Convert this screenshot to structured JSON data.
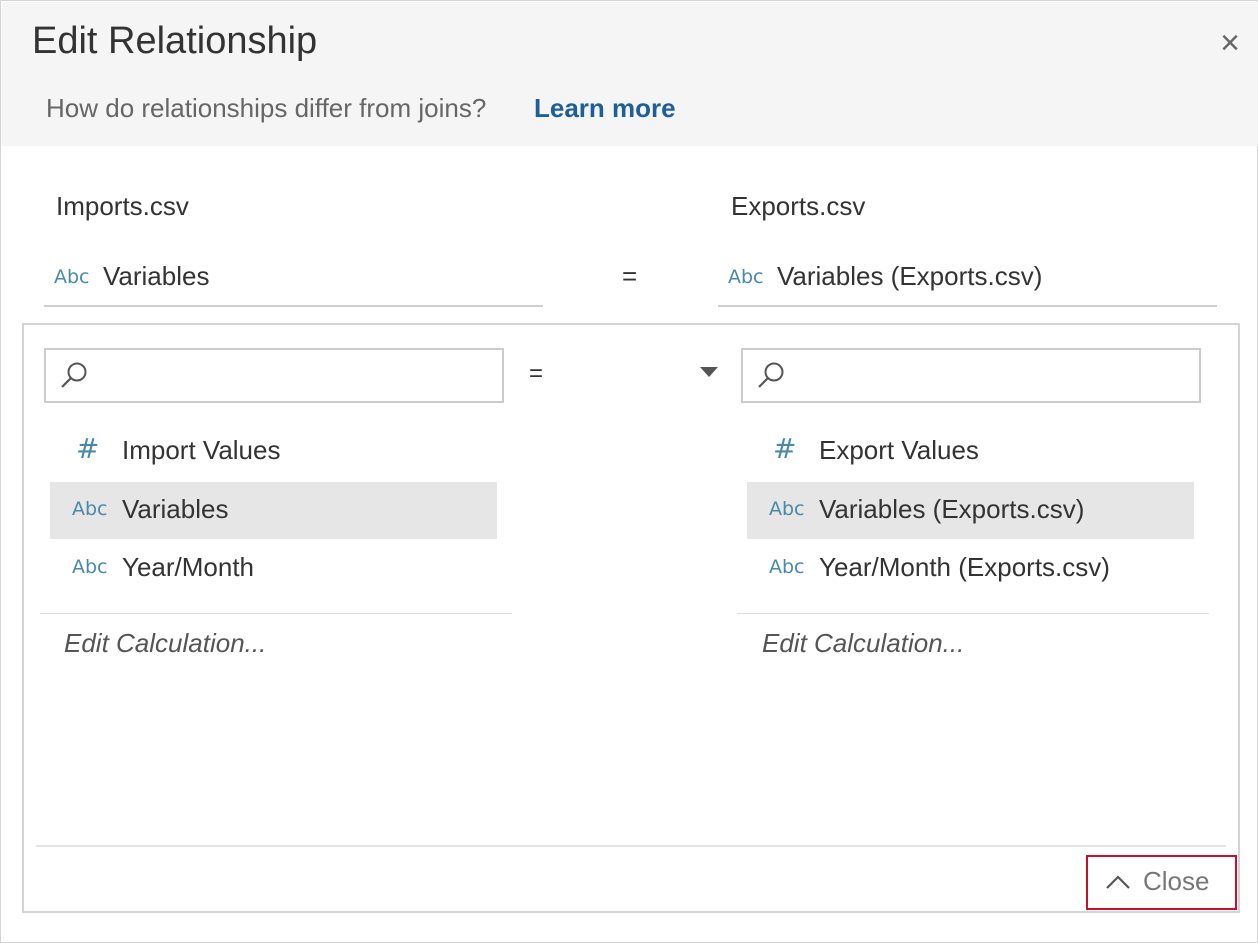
{
  "dialog": {
    "title": "Edit Relationship",
    "close_icon": "close-icon",
    "subtitle": "How do relationships differ from joins?",
    "learn_more": "Learn more"
  },
  "left": {
    "table_name": "Imports.csv",
    "selected_field": {
      "type_label": "Abc",
      "name": "Variables"
    },
    "search_placeholder": "",
    "fields": [
      {
        "type": "number",
        "type_label": "#",
        "name": "Import Values",
        "selected": false
      },
      {
        "type": "string",
        "type_label": "Abc",
        "name": "Variables",
        "selected": true
      },
      {
        "type": "string",
        "type_label": "Abc",
        "name": "Year/Month",
        "selected": false
      }
    ],
    "edit_calc": "Edit Calculation..."
  },
  "right": {
    "table_name": "Exports.csv",
    "selected_field": {
      "type_label": "Abc",
      "name": "Variables (Exports.csv)"
    },
    "search_placeholder": "",
    "fields": [
      {
        "type": "number",
        "type_label": "#",
        "name": "Export Values",
        "selected": false
      },
      {
        "type": "string",
        "type_label": "Abc",
        "name": "Variables (Exports.csv)",
        "selected": true
      },
      {
        "type": "string",
        "type_label": "Abc",
        "name": "Year/Month (Exports.csv)",
        "selected": false
      }
    ],
    "edit_calc": "Edit Calculation..."
  },
  "operator": "=",
  "close_button": {
    "label": "Close",
    "icon": "chevron-up-icon"
  },
  "colors": {
    "link": "#1f5f99",
    "field_type_icon": "#4a8aa8",
    "selected_row": "#e6e6e6",
    "close_highlight": "#c8102e",
    "header_bg": "#f5f5f5"
  }
}
